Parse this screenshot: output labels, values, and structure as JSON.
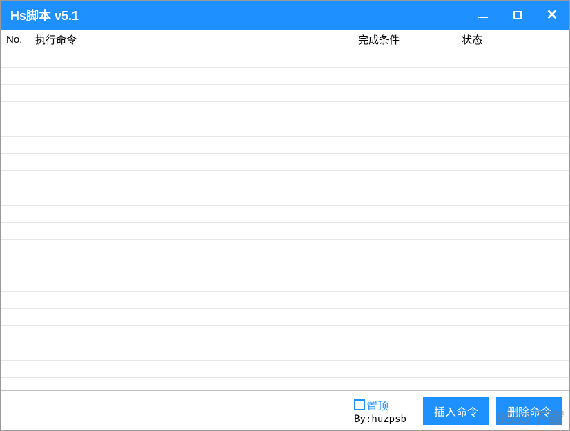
{
  "window": {
    "title": "Hs脚本 v5.1"
  },
  "table": {
    "headers": {
      "no": "No.",
      "command": "执行命令",
      "condition": "完成条件",
      "status": "状态"
    }
  },
  "footer": {
    "pin_top_label": "置顶",
    "byline": "By:huzpsb",
    "insert_button": "插入命令",
    "delete_button": "删除命令"
  },
  "watermark": "9553下载"
}
